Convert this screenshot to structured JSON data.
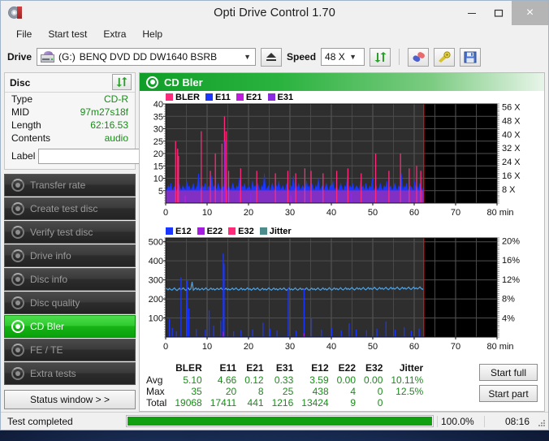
{
  "window": {
    "title": "Opti Drive Control 1.70",
    "minimize": "–",
    "maximize": "☐",
    "close": "×"
  },
  "menu": {
    "items": [
      "File",
      "Start test",
      "Extra",
      "Help"
    ]
  },
  "toolbar": {
    "drive_label": "Drive",
    "drive_letter": "(G:)",
    "drive_name": "BENQ DVD DD DW1640 BSRB",
    "eject_title": "Eject",
    "speed_label": "Speed",
    "speed_value": "48 X",
    "refresh_title": "Refresh",
    "erase_title": "Erase",
    "tools_title": "Tools",
    "save_title": "Save"
  },
  "disc": {
    "header": "Disc",
    "rows": [
      {
        "key": "Type",
        "value": "CD-R"
      },
      {
        "key": "MID",
        "value": "97m27s18f"
      },
      {
        "key": "Length",
        "value": "62:16.53"
      },
      {
        "key": "Contents",
        "value": "audio"
      }
    ],
    "label_key": "Label",
    "label_value": "",
    "label_placeholder": ""
  },
  "sidebar": {
    "items": [
      {
        "label": "Transfer rate",
        "active": false
      },
      {
        "label": "Create test disc",
        "active": false
      },
      {
        "label": "Verify test disc",
        "active": false
      },
      {
        "label": "Drive info",
        "active": false
      },
      {
        "label": "Disc info",
        "active": false
      },
      {
        "label": "Disc quality",
        "active": false
      },
      {
        "label": "CD Bler",
        "active": true
      },
      {
        "label": "FE / TE",
        "active": false
      },
      {
        "label": "Extra tests",
        "active": false
      }
    ],
    "status_window": "Status window > >"
  },
  "tab": {
    "title": "CD Bler"
  },
  "actions": {
    "start_full": "Start full",
    "start_part": "Start part"
  },
  "statusbar": {
    "text": "Test completed",
    "percent_label": "100.0%",
    "percent_value": 100,
    "elapsed": "08:16"
  },
  "stats": {
    "columns": [
      "BLER",
      "E11",
      "E21",
      "E31",
      "E12",
      "E22",
      "E32",
      "Jitter"
    ],
    "rows": [
      {
        "label": "Avg",
        "values": [
          "5.10",
          "4.66",
          "0.12",
          "0.33",
          "3.59",
          "0.00",
          "0.00",
          "10.11%"
        ]
      },
      {
        "label": "Max",
        "values": [
          "35",
          "20",
          "8",
          "25",
          "438",
          "4",
          "0",
          "12.5%"
        ]
      },
      {
        "label": "Total",
        "values": [
          "19068",
          "17411",
          "441",
          "1216",
          "13424",
          "9",
          "0",
          ""
        ]
      }
    ]
  },
  "chart_data": [
    {
      "id": "bler-chart",
      "type": "line",
      "title": "CD Bler - error rates",
      "xlabel": "min",
      "ylabel": "",
      "xlim": [
        0,
        80
      ],
      "ylim": [
        0,
        40
      ],
      "xticks": [
        0,
        10,
        20,
        30,
        40,
        50,
        60,
        70,
        80
      ],
      "yticks": [
        5,
        10,
        15,
        20,
        25,
        30,
        35,
        40
      ],
      "y2label": "X",
      "y2lim": [
        0,
        60
      ],
      "y2ticks": [
        "8 X",
        "16 X",
        "24 X",
        "32 X",
        "40 X",
        "48 X",
        "56 X"
      ],
      "grid": true,
      "legend_position": "top-left",
      "data_end_min": 62.3,
      "legend": [
        {
          "name": "BLER",
          "color": "#ff2a7a"
        },
        {
          "name": "E11",
          "color": "#1a36ff"
        },
        {
          "name": "E21",
          "color": "#c01ce0"
        },
        {
          "name": "E31",
          "color": "#8a2be2"
        }
      ],
      "series": [
        {
          "name": "E11",
          "color": "#1a36ff",
          "kind": "filled-spikes",
          "baseline": 4.7,
          "values": [
            6,
            5,
            7,
            6,
            8,
            5,
            6,
            7,
            5,
            6,
            8,
            6,
            5,
            7,
            6,
            5,
            9,
            6,
            7,
            5,
            6,
            8,
            5,
            6,
            7,
            12,
            6,
            5,
            7,
            6,
            8,
            5,
            6,
            7,
            5,
            11,
            6,
            7,
            5,
            6,
            8,
            6,
            5,
            7,
            6,
            9,
            5,
            6,
            7,
            5,
            6,
            8,
            6,
            5,
            7,
            6,
            10,
            5,
            7,
            6,
            8,
            5,
            6,
            7,
            6,
            5,
            9,
            6,
            7,
            5,
            8,
            6,
            5,
            7,
            6,
            12,
            5,
            6,
            7,
            5,
            6,
            8,
            6,
            5,
            7,
            6,
            9,
            5,
            6,
            7,
            5,
            6,
            8,
            6,
            5,
            7,
            6,
            11,
            5,
            7,
            6,
            8,
            5,
            6,
            7,
            6,
            5,
            9,
            6,
            7,
            5,
            8,
            6,
            5,
            7,
            6,
            10,
            5,
            6,
            7,
            5,
            6,
            8,
            6,
            5,
            7,
            6,
            9,
            5,
            6,
            7,
            5,
            6,
            8,
            6,
            5,
            7,
            6,
            11,
            5,
            7,
            6,
            8,
            5,
            6,
            7,
            6,
            5,
            9,
            6,
            7,
            5,
            8,
            6,
            5,
            7,
            6,
            10,
            5,
            6,
            7,
            5,
            6,
            8,
            6,
            5,
            7,
            6,
            9,
            5,
            6,
            7,
            5,
            6,
            8,
            6,
            5,
            7,
            6,
            12,
            5,
            7,
            6,
            8,
            5,
            6,
            7,
            6,
            5,
            9,
            6,
            7,
            5,
            8,
            6,
            5,
            7
          ]
        },
        {
          "name": "BLER",
          "color": "#ff2a7a",
          "kind": "spikes",
          "baseline": 5.1,
          "peaks": [
            {
              "min": 2.4,
              "value": 25
            },
            {
              "min": 2.9,
              "value": 22
            },
            {
              "min": 3.1,
              "value": 19
            },
            {
              "min": 8.6,
              "value": 29
            },
            {
              "min": 10.8,
              "value": 13
            },
            {
              "min": 12.0,
              "value": 20
            },
            {
              "min": 13.6,
              "value": 24
            },
            {
              "min": 14.2,
              "value": 35
            },
            {
              "min": 14.6,
              "value": 29
            },
            {
              "min": 15.2,
              "value": 13
            },
            {
              "min": 18.1,
              "value": 14
            },
            {
              "min": 22.0,
              "value": 13
            },
            {
              "min": 26.5,
              "value": 12
            },
            {
              "min": 29.5,
              "value": 13
            },
            {
              "min": 31.4,
              "value": 12
            },
            {
              "min": 33.6,
              "value": 14
            },
            {
              "min": 35.1,
              "value": 13
            },
            {
              "min": 38.0,
              "value": 12
            },
            {
              "min": 41.3,
              "value": 13
            },
            {
              "min": 44.0,
              "value": 14
            },
            {
              "min": 47.2,
              "value": 12
            },
            {
              "min": 50.7,
              "value": 20
            },
            {
              "min": 53.9,
              "value": 13
            },
            {
              "min": 56.7,
              "value": 20
            },
            {
              "min": 58.8,
              "value": 14
            },
            {
              "min": 60.6,
              "value": 15
            },
            {
              "min": 61.6,
              "value": 13
            }
          ]
        },
        {
          "name": "E21",
          "color": "#c01ce0",
          "kind": "spikes",
          "baseline": 0.12,
          "peaks": [
            {
              "min": 14.2,
              "value": 8
            },
            {
              "min": 17.9,
              "value": 5
            },
            {
              "min": 4.7,
              "value": 3
            },
            {
              "min": 30.2,
              "value": 3
            }
          ]
        },
        {
          "name": "E31",
          "color": "#8a2be2",
          "kind": "spikes",
          "baseline": 0.33,
          "peaks": [
            {
              "min": 14.3,
              "value": 25
            },
            {
              "min": 20.5,
              "value": 4
            },
            {
              "min": 44.8,
              "value": 4
            }
          ]
        }
      ]
    },
    {
      "id": "jitter-chart",
      "type": "line",
      "title": "CD Bler - E12/E22/E32 and Jitter",
      "xlabel": "min",
      "ylabel": "",
      "xlim": [
        0,
        80
      ],
      "ylim": [
        0,
        520
      ],
      "xticks": [
        0,
        10,
        20,
        30,
        40,
        50,
        60,
        70,
        80
      ],
      "yticks": [
        100,
        200,
        300,
        400,
        500
      ],
      "y2label": "%",
      "y2lim": [
        0,
        21
      ],
      "y2ticks": [
        "4%",
        "8%",
        "12%",
        "16%",
        "20%"
      ],
      "grid": true,
      "legend_position": "top-left",
      "data_end_min": 62.3,
      "legend": [
        {
          "name": "E12",
          "color": "#1a36ff"
        },
        {
          "name": "E22",
          "color": "#a31ce0"
        },
        {
          "name": "E32",
          "color": "#ff2a7a"
        },
        {
          "name": "Jitter",
          "color": "#4d8c8c"
        }
      ],
      "series": [
        {
          "name": "Jitter",
          "color": "#4aa3e8",
          "kind": "line",
          "avg_percent": 10.11,
          "max_percent": 12.5,
          "values": [
            258,
            252,
            248,
            255,
            250,
            246,
            252,
            258,
            249,
            244,
            250,
            256,
            247,
            252,
            258,
            250,
            245,
            251,
            257,
            248,
            253,
            290,
            246,
            252,
            258,
            249,
            255,
            247,
            251,
            256,
            248,
            252,
            258,
            250,
            246,
            252,
            257,
            249,
            254,
            247,
            251,
            256,
            249,
            252,
            258,
            250,
            245,
            251,
            256,
            248,
            253,
            247,
            251,
            257,
            249,
            252,
            258,
            250,
            246,
            251,
            257,
            248,
            253,
            247,
            252,
            258,
            249,
            254,
            246,
            251,
            257,
            249,
            252,
            258,
            250,
            245,
            251,
            256,
            248,
            253,
            247,
            252,
            258,
            250,
            246,
            252,
            257,
            249,
            254,
            247,
            251,
            256,
            249,
            252,
            258,
            250,
            245,
            251,
            257,
            248,
            253,
            247,
            252,
            258,
            250,
            246,
            252,
            257,
            249,
            253,
            247,
            252,
            258,
            250,
            245,
            251,
            257,
            249,
            254,
            247,
            252,
            258,
            250,
            246,
            252,
            258,
            249,
            254,
            247,
            252,
            259,
            251,
            246,
            252,
            258,
            250,
            255,
            248,
            253,
            259,
            251,
            247,
            253,
            259,
            250,
            255,
            249,
            254,
            260,
            252,
            247,
            253,
            259,
            251,
            256,
            249,
            254,
            260,
            252,
            248,
            254,
            260,
            251,
            256,
            250,
            255,
            261,
            253,
            248,
            254,
            260,
            252,
            257,
            250,
            255,
            261,
            253,
            249,
            255,
            261,
            252,
            257,
            251,
            256,
            262,
            254,
            249,
            255,
            261,
            253,
            258,
            251,
            256,
            262,
            254,
            250,
            256,
            262,
            253,
            258,
            252,
            257,
            263,
            255,
            250,
            256
          ]
        },
        {
          "name": "E12",
          "color": "#1a36ff",
          "kind": "spikes",
          "baseline": 3.59,
          "peaks": [
            {
              "min": 0.9,
              "value": 95
            },
            {
              "min": 1.6,
              "value": 48
            },
            {
              "min": 2.6,
              "value": 30
            },
            {
              "min": 3.7,
              "value": 314
            },
            {
              "min": 5.2,
              "value": 297
            },
            {
              "min": 5.6,
              "value": 150
            },
            {
              "min": 7.4,
              "value": 42
            },
            {
              "min": 9.6,
              "value": 38
            },
            {
              "min": 10.5,
              "value": 140
            },
            {
              "min": 11.6,
              "value": 60
            },
            {
              "min": 13.3,
              "value": 88
            },
            {
              "min": 13.9,
              "value": 438
            },
            {
              "min": 14.1,
              "value": 385
            },
            {
              "min": 16.4,
              "value": 30
            },
            {
              "min": 18.2,
              "value": 36
            },
            {
              "min": 21.0,
              "value": 40
            },
            {
              "min": 23.5,
              "value": 76
            },
            {
              "min": 25.2,
              "value": 44
            },
            {
              "min": 26.9,
              "value": 35
            },
            {
              "min": 29.6,
              "value": 258
            },
            {
              "min": 31.5,
              "value": 34
            },
            {
              "min": 33.4,
              "value": 256
            },
            {
              "min": 35.2,
              "value": 102
            },
            {
              "min": 37.6,
              "value": 38
            },
            {
              "min": 40.1,
              "value": 46
            },
            {
              "min": 42.4,
              "value": 35
            },
            {
              "min": 44.3,
              "value": 72
            },
            {
              "min": 46.0,
              "value": 40
            },
            {
              "min": 48.5,
              "value": 36
            },
            {
              "min": 51.0,
              "value": 44
            },
            {
              "min": 53.2,
              "value": 82
            },
            {
              "min": 55.4,
              "value": 38
            },
            {
              "min": 57.6,
              "value": 52
            },
            {
              "min": 59.3,
              "value": 34
            },
            {
              "min": 61.2,
              "value": 44
            }
          ]
        },
        {
          "name": "E22",
          "color": "#a31ce0",
          "kind": "spikes",
          "baseline": 0,
          "peaks": [
            {
              "min": 13.9,
              "value": 28
            },
            {
              "min": 33.4,
              "value": 20
            }
          ]
        },
        {
          "name": "E32",
          "color": "#ff2a7a",
          "kind": "spikes",
          "baseline": 0,
          "peaks": []
        }
      ]
    }
  ]
}
